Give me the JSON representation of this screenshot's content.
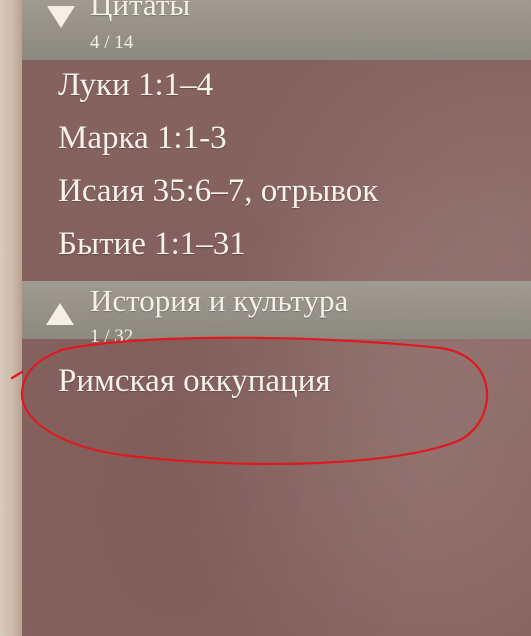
{
  "sections": [
    {
      "title": "Цитаты",
      "count": "4 / 14",
      "expanded": true,
      "items": [
        "Луки 1:1–4",
        "Марка 1:1-3",
        "Исаия 35:6–7, отрывок",
        "Бытие 1:1–31"
      ]
    },
    {
      "title": "История и культура",
      "count": "1 / 32",
      "expanded": false,
      "items": [
        "Римская оккупация"
      ]
    }
  ],
  "colors": {
    "panel": "#86625f",
    "header": "#9a968d",
    "text": "#f7f2ea",
    "annotation": "#e0191e"
  },
  "icons": {
    "expanded": "triangle-down-icon",
    "collapsed": "triangle-up-icon"
  }
}
